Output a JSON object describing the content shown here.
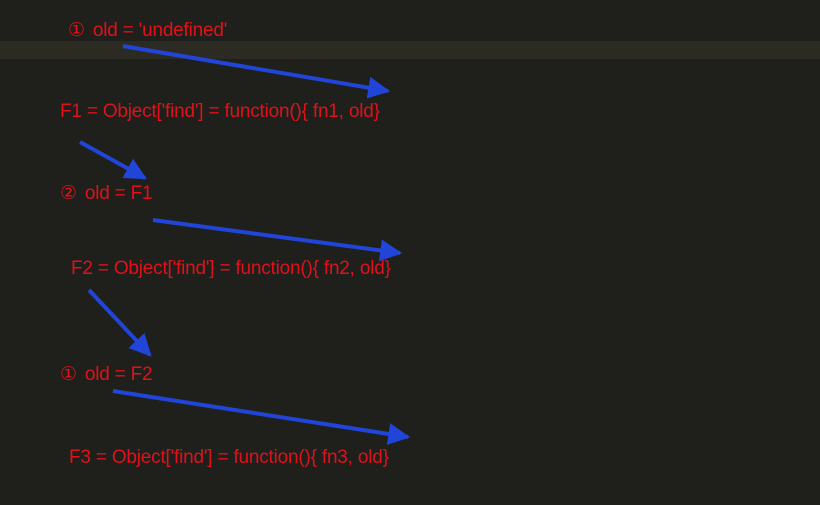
{
  "colors": {
    "background": "#1f201c",
    "highlight": "#2b2b24",
    "text": "#e0111b",
    "arrow": "#2145d8"
  },
  "lines": [
    {
      "step": "①",
      "text": "old = 'undefined'"
    },
    {
      "step": "",
      "text": "F1 = Object['find'] = function(){ fn1, old}"
    },
    {
      "step": "②",
      "text": "old = F1"
    },
    {
      "step": "",
      "text": "F2 = Object['find'] = function(){ fn2, old}"
    },
    {
      "step": "①",
      "text": "old = F2"
    },
    {
      "step": "",
      "text": "F3 = Object['find'] = function(){ fn3, old}"
    }
  ]
}
